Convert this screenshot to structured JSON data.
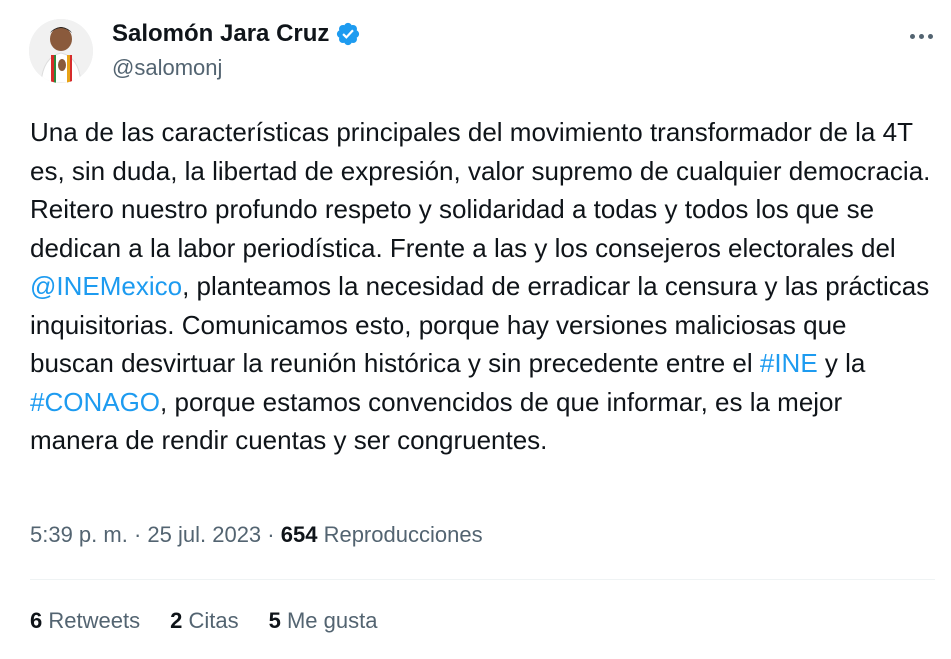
{
  "author": {
    "name": "Salomón Jara Cruz",
    "handle": "@salomonj",
    "verified_color": "#1d9bf0"
  },
  "tweet": {
    "segments": [
      {
        "type": "text",
        "text": "Una de las características principales del movimiento transformador de la 4T es, sin duda, la libertad de expresión, valor supremo de cualquier democracia. Reitero nuestro profundo respeto y solidaridad a todas y todos los que se dedican a la labor periodística. Frente a las y los consejeros electorales del "
      },
      {
        "type": "link",
        "text": "@INEMexico"
      },
      {
        "type": "text",
        "text": ", planteamos la necesidad de erradicar la censura y las prácticas inquisitorias. Comunicamos esto, porque hay versiones maliciosas que buscan desvirtuar la reunión histórica y sin precedente entre el "
      },
      {
        "type": "link",
        "text": "#INE"
      },
      {
        "type": "text",
        "text": " y la "
      },
      {
        "type": "link",
        "text": "#CONAGO"
      },
      {
        "type": "text",
        "text": ", porque estamos convencidos de que informar, es la mejor manera de rendir cuentas y ser congruentes."
      }
    ]
  },
  "meta": {
    "time": "5:39 p. m.",
    "sep": " · ",
    "date": "25 jul. 2023",
    "views_count": "654",
    "views_label": "Reproducciones"
  },
  "stats": {
    "retweets_count": "6",
    "retweets_label": "Retweets",
    "quotes_count": "2",
    "quotes_label": "Citas",
    "likes_count": "5",
    "likes_label": "Me gusta"
  },
  "icons": {
    "avatar": "avatar-photo",
    "verified": "verified-badge-icon",
    "more": "more-options-icon"
  }
}
